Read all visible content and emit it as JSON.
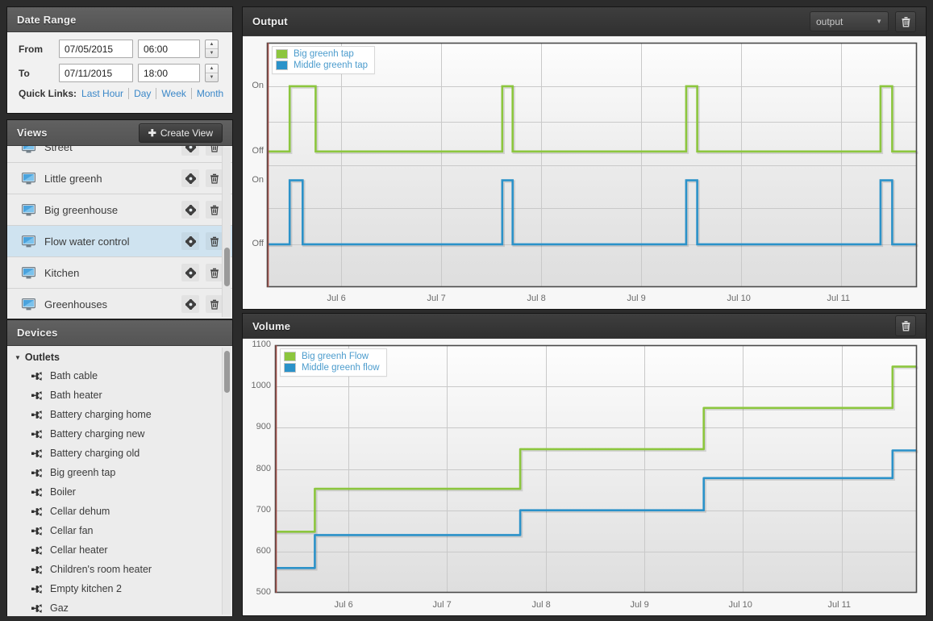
{
  "date_range": {
    "title": "Date Range",
    "from_label": "From",
    "to_label": "To",
    "from_date": "07/05/2015",
    "from_time": "06:00",
    "to_date": "07/11/2015",
    "to_time": "18:00",
    "quick_links_label": "Quick Links:",
    "quick_links": [
      "Last Hour",
      "Day",
      "Week",
      "Month"
    ]
  },
  "views": {
    "title": "Views",
    "create_button": "Create View",
    "items": [
      {
        "label": "Street",
        "selected": false
      },
      {
        "label": "Little greenh",
        "selected": false
      },
      {
        "label": "Big greenhouse",
        "selected": false
      },
      {
        "label": "Flow water control",
        "selected": true
      },
      {
        "label": "Kitchen",
        "selected": false
      },
      {
        "label": "Greenhouses",
        "selected": false
      }
    ]
  },
  "devices": {
    "title": "Devices",
    "group_label": "Outlets",
    "items": [
      "Bath cable",
      "Bath heater",
      "Battery charging home",
      "Battery charging new",
      "Battery charging old",
      "Big greenh tap",
      "Boiler",
      "Cellar dehum",
      "Cellar fan",
      "Cellar heater",
      "Children's room heater",
      "Empty kitchen 2",
      "Gaz"
    ]
  },
  "output_panel": {
    "title": "Output",
    "select_value": "output",
    "delete_tooltip": "delete"
  },
  "volume_panel": {
    "title": "Volume",
    "delete_tooltip": "delete"
  },
  "colors": {
    "green": "#8cc63e",
    "blue": "#2b92c9",
    "legend_text": "#4c9ccd",
    "panel_dark": "#353535",
    "selected_row": "#cfe3f0"
  },
  "chart_data": [
    {
      "id": "output",
      "type": "line",
      "title": "Output",
      "xlabel": "",
      "ylabel": "",
      "grid": true,
      "legend_position": "top-left",
      "x_ticks": [
        "Jul 6",
        "Jul 7",
        "Jul 8",
        "Jul 9",
        "Jul 10",
        "Jul 11"
      ],
      "x_range": [
        "2015-07-05 06:00",
        "2015-07-11 18:00"
      ],
      "subplots": [
        {
          "name": "Big greenh tap",
          "color": "#8cc63e",
          "y_ticks": [
            "On",
            "Off"
          ],
          "ylim": [
            0,
            1
          ],
          "pulses": [
            {
              "start": 0.035,
              "end": 0.075
            },
            {
              "start": 0.362,
              "end": 0.378
            },
            {
              "start": 0.645,
              "end": 0.662
            },
            {
              "start": 0.944,
              "end": 0.962
            }
          ]
        },
        {
          "name": "Middle greenh tap",
          "color": "#2b92c9",
          "y_ticks": [
            "On",
            "Off"
          ],
          "ylim": [
            0,
            1
          ],
          "pulses": [
            {
              "start": 0.035,
              "end": 0.055
            },
            {
              "start": 0.362,
              "end": 0.378
            },
            {
              "start": 0.645,
              "end": 0.662
            },
            {
              "start": 0.944,
              "end": 0.962
            }
          ]
        }
      ]
    },
    {
      "id": "volume",
      "type": "line",
      "title": "Volume",
      "xlabel": "",
      "ylabel": "",
      "grid": true,
      "legend_position": "top-left",
      "ylim": [
        500,
        1100
      ],
      "y_ticks": [
        500,
        600,
        700,
        800,
        900,
        1000,
        1100
      ],
      "x_ticks": [
        "Jul 6",
        "Jul 7",
        "Jul 8",
        "Jul 9",
        "Jul 10",
        "Jul 11"
      ],
      "x_range": [
        "2015-07-05 06:00",
        "2015-07-11 18:00"
      ],
      "series": [
        {
          "name": "Big greenh Flow",
          "color": "#8cc63e",
          "steps": [
            {
              "x": 0.0,
              "y": 648
            },
            {
              "x": 0.038,
              "y": 648
            },
            {
              "x": 0.062,
              "y": 752
            },
            {
              "x": 0.363,
              "y": 752
            },
            {
              "x": 0.382,
              "y": 848
            },
            {
              "x": 0.648,
              "y": 848
            },
            {
              "x": 0.668,
              "y": 948
            },
            {
              "x": 0.945,
              "y": 948
            },
            {
              "x": 0.962,
              "y": 1048
            },
            {
              "x": 1.0,
              "y": 1048
            }
          ]
        },
        {
          "name": "Middle greenh flow",
          "color": "#2b92c9",
          "steps": [
            {
              "x": 0.0,
              "y": 560
            },
            {
              "x": 0.038,
              "y": 560
            },
            {
              "x": 0.062,
              "y": 640
            },
            {
              "x": 0.363,
              "y": 640
            },
            {
              "x": 0.382,
              "y": 700
            },
            {
              "x": 0.648,
              "y": 700
            },
            {
              "x": 0.668,
              "y": 778
            },
            {
              "x": 0.945,
              "y": 778
            },
            {
              "x": 0.962,
              "y": 845
            },
            {
              "x": 1.0,
              "y": 845
            }
          ]
        }
      ]
    }
  ]
}
